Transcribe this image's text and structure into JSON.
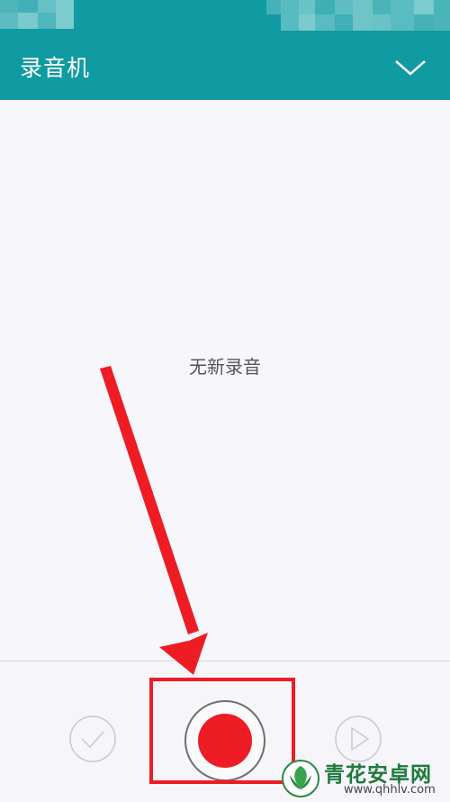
{
  "app": {
    "title": "录音机",
    "colors": {
      "header": "#0f9ba1",
      "background": "#f7f6fa",
      "record": "#ee1c25",
      "annotation": "#ee1c25"
    }
  },
  "header": {
    "dropdown_icon": "chevron-down-icon"
  },
  "main": {
    "empty_message": "无新录音"
  },
  "controls": {
    "confirm_icon": "check-circle-icon",
    "record_icon": "record-icon",
    "play_icon": "play-icon"
  },
  "watermark": {
    "name": "青花安卓网",
    "url": "www.qhhlv.com"
  }
}
